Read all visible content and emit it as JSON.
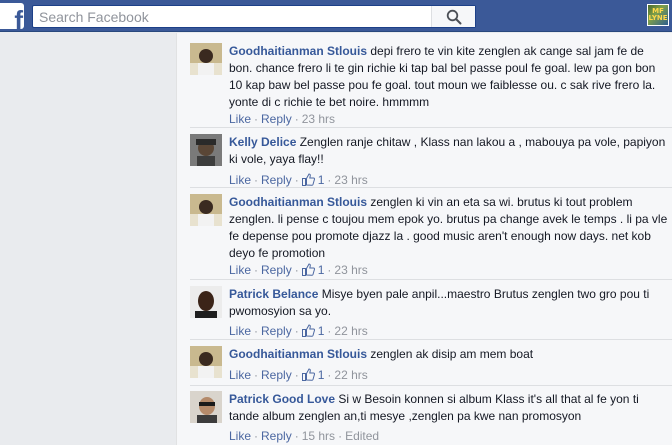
{
  "topbar": {
    "logo_letter": "f",
    "search_placeholder": "Search Facebook",
    "profile_badge": "MF LYNE"
  },
  "comments": [
    {
      "author": "Goodhaitianman Stlouis",
      "text": "depi frero te vin kite zenglen ak cange sal jam fe de bon. chance frero li te gin richie ki tap bal bel passe poul fe goal. lew pa gon bon 10 kap baw bel passe pou fe goal. tout moun we faiblesse ou. c sak rive frero la. yonte di c richie te bet noire. hmmmm",
      "like_label": "Like",
      "reply_label": "Reply",
      "likes": "",
      "time": "23 hrs",
      "edited": ""
    },
    {
      "author": "Kelly Delice",
      "text": "Zenglen ranje chitaw , Klass nan lakou a , mabouya pa vole, papiyon ki vole, yaya flay!!",
      "like_label": "Like",
      "reply_label": "Reply",
      "likes": "1",
      "time": "23 hrs",
      "edited": ""
    },
    {
      "author": "Goodhaitianman Stlouis",
      "text": "zenglen ki vin an eta sa wi. brutus ki tout problem zenglen. li pense c toujou mem epok yo. brutus pa change avek le temps . li pa vle fe depense pou promote djazz la . good music aren't enough now days. net kob deyo fe promotion",
      "like_label": "Like",
      "reply_label": "Reply",
      "likes": "1",
      "time": "23 hrs",
      "edited": ""
    },
    {
      "author": "Patrick Belance",
      "text": "Misye byen pale anpil...maestro Brutus zenglen two gro pou ti pwomosyion sa yo.",
      "like_label": "Like",
      "reply_label": "Reply",
      "likes": "1",
      "time": "22 hrs",
      "edited": ""
    },
    {
      "author": "Goodhaitianman Stlouis",
      "text": "zenglen ak disip am mem boat",
      "like_label": "Like",
      "reply_label": "Reply",
      "likes": "1",
      "time": "22 hrs",
      "edited": ""
    },
    {
      "author": "Patrick Good Love",
      "text": "Si w Besoin konnen si album Klass it's all that al fe yon ti tande album zenglen an,ti mesye ,zenglen pa kwe nan promosyon",
      "like_label": "Like",
      "reply_label": "Reply",
      "likes": "",
      "time": "15 hrs",
      "edited": "Edited"
    }
  ],
  "colors": {
    "topbar": "#3b5998",
    "author_link": "#365899",
    "action_link": "#4b67a1",
    "meta_text": "#90949c",
    "panel_bg": "#f6f7f9",
    "page_bg": "#e9ebee"
  }
}
